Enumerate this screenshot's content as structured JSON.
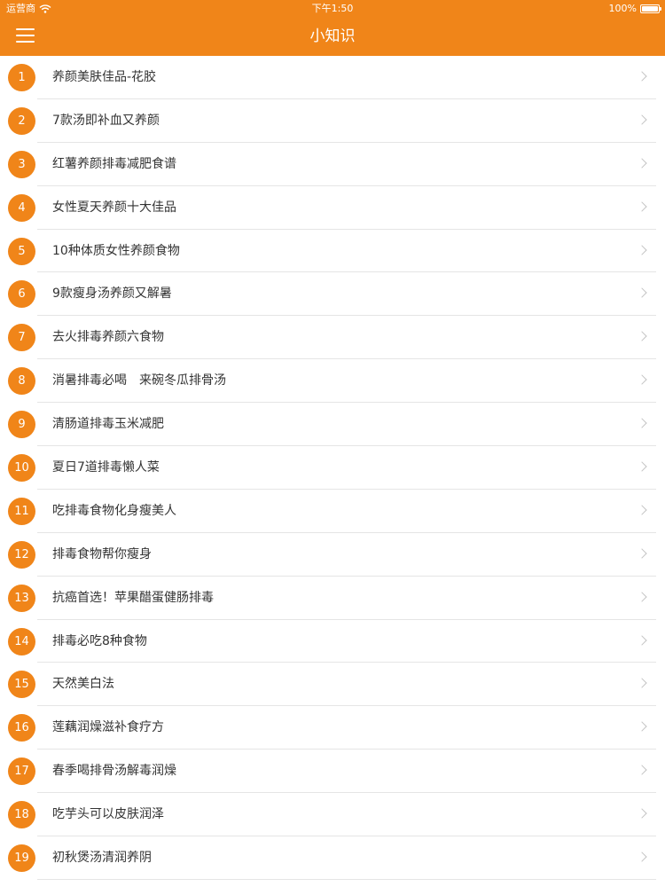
{
  "status_bar": {
    "carrier": "运营商",
    "time": "下午1:50",
    "battery": "100%"
  },
  "nav": {
    "title": "小知识",
    "menu_icon": "hamburger-menu-icon"
  },
  "colors": {
    "accent": "#f08519",
    "text": "#333333",
    "chevron": "#c4c4c4"
  },
  "items": [
    {
      "num": "1",
      "label": "养颜美肤佳品-花胶"
    },
    {
      "num": "2",
      "label": "7款汤即补血又养颜"
    },
    {
      "num": "3",
      "label": "红薯养颜排毒减肥食谱"
    },
    {
      "num": "4",
      "label": "女性夏天养颜十大佳品"
    },
    {
      "num": "5",
      "label": "10种体质女性养颜食物"
    },
    {
      "num": "6",
      "label": "9款瘦身汤养颜又解暑"
    },
    {
      "num": "7",
      "label": "去火排毒养颜六食物"
    },
    {
      "num": "8",
      "label": "消暑排毒必喝　来碗冬瓜排骨汤"
    },
    {
      "num": "9",
      "label": "清肠道排毒玉米减肥"
    },
    {
      "num": "10",
      "label": "夏日7道排毒懒人菜"
    },
    {
      "num": "11",
      "label": "吃排毒食物化身瘦美人"
    },
    {
      "num": "12",
      "label": "排毒食物帮你瘦身"
    },
    {
      "num": "13",
      "label": "抗癌首选！苹果醋蛋健肠排毒"
    },
    {
      "num": "14",
      "label": "排毒必吃8种食物"
    },
    {
      "num": "15",
      "label": "天然美白法"
    },
    {
      "num": "16",
      "label": "莲藕润燥滋补食疗方"
    },
    {
      "num": "17",
      "label": "春季喝排骨汤解毒润燥"
    },
    {
      "num": "18",
      "label": "吃芋头可以皮肤润泽"
    },
    {
      "num": "19",
      "label": "初秋煲汤清润养阴"
    }
  ]
}
